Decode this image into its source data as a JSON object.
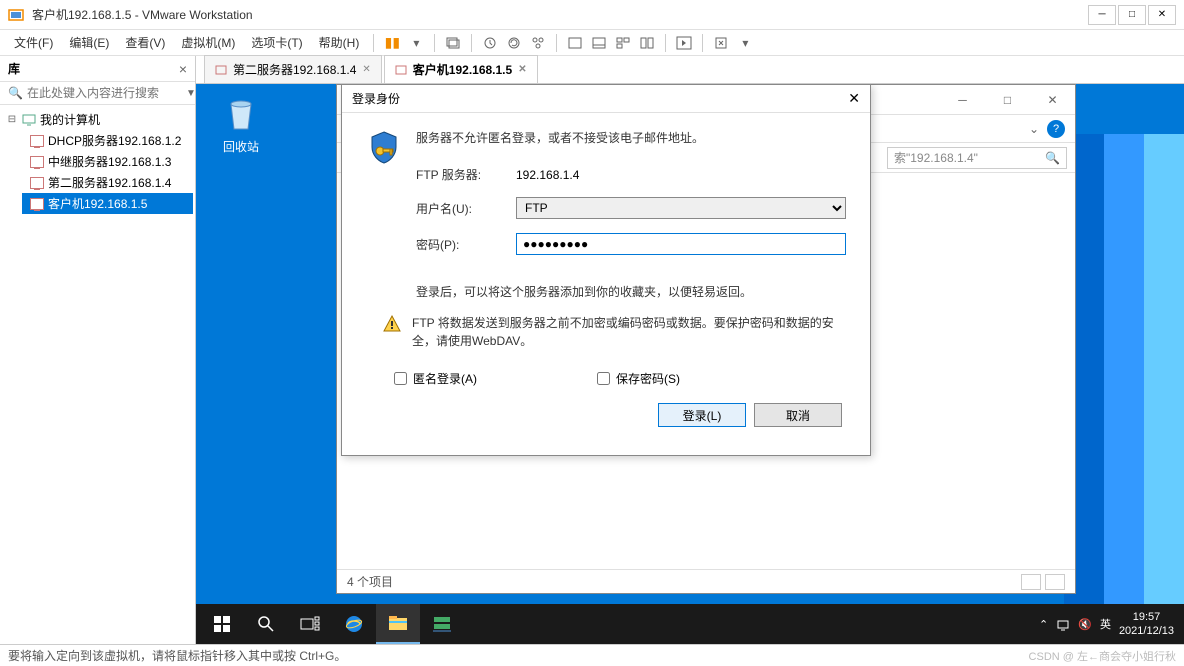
{
  "vmware": {
    "title": "客户机192.168.1.5 - VMware Workstation",
    "menus": [
      "文件(F)",
      "编辑(E)",
      "查看(V)",
      "虚拟机(M)",
      "选项卡(T)",
      "帮助(H)"
    ],
    "status": "要将输入定向到该虚拟机，请将鼠标指针移入其中或按 Ctrl+G。",
    "watermark": "CSDN @ 左←商会夺小姐行秋"
  },
  "sidebar": {
    "title": "库",
    "search_placeholder": "在此处键入内容进行搜索",
    "root": "我的计算机",
    "vms": [
      "DHCP服务器192.168.1.2",
      "中继服务器192.168.1.3",
      "第二服务器192.168.1.4",
      "客户机192.168.1.5"
    ],
    "selected_index": 3
  },
  "tabs": [
    {
      "label": "第二服务器192.168.1.4",
      "active": false
    },
    {
      "label": "客户机192.168.1.5",
      "active": true
    }
  ],
  "guest": {
    "recycle_bin": "回收站",
    "explorer": {
      "search_placeholder": "索\"192.168.1.4\"",
      "status": "4 个项目"
    },
    "taskbar": {
      "ime": "英",
      "time": "19:57",
      "date": "2021/12/13"
    }
  },
  "dialog": {
    "title": "登录身份",
    "message": "服务器不允许匿名登录，或者不接受该电子邮件地址。",
    "server_label": "FTP 服务器:",
    "server_value": "192.168.1.4",
    "user_label": "用户名(U):",
    "user_value": "FTP",
    "pass_label": "密码(P):",
    "pass_value": "●●●●●●●●●",
    "hint": "登录后，可以将这个服务器添加到你的收藏夹，以便轻易返回。",
    "warning": "FTP 将数据发送到服务器之前不加密或编码密码或数据。要保护密码和数据的安全，请使用WebDAV。",
    "anon_label": "匿名登录(A)",
    "save_label": "保存密码(S)",
    "login_btn": "登录(L)",
    "cancel_btn": "取消"
  }
}
